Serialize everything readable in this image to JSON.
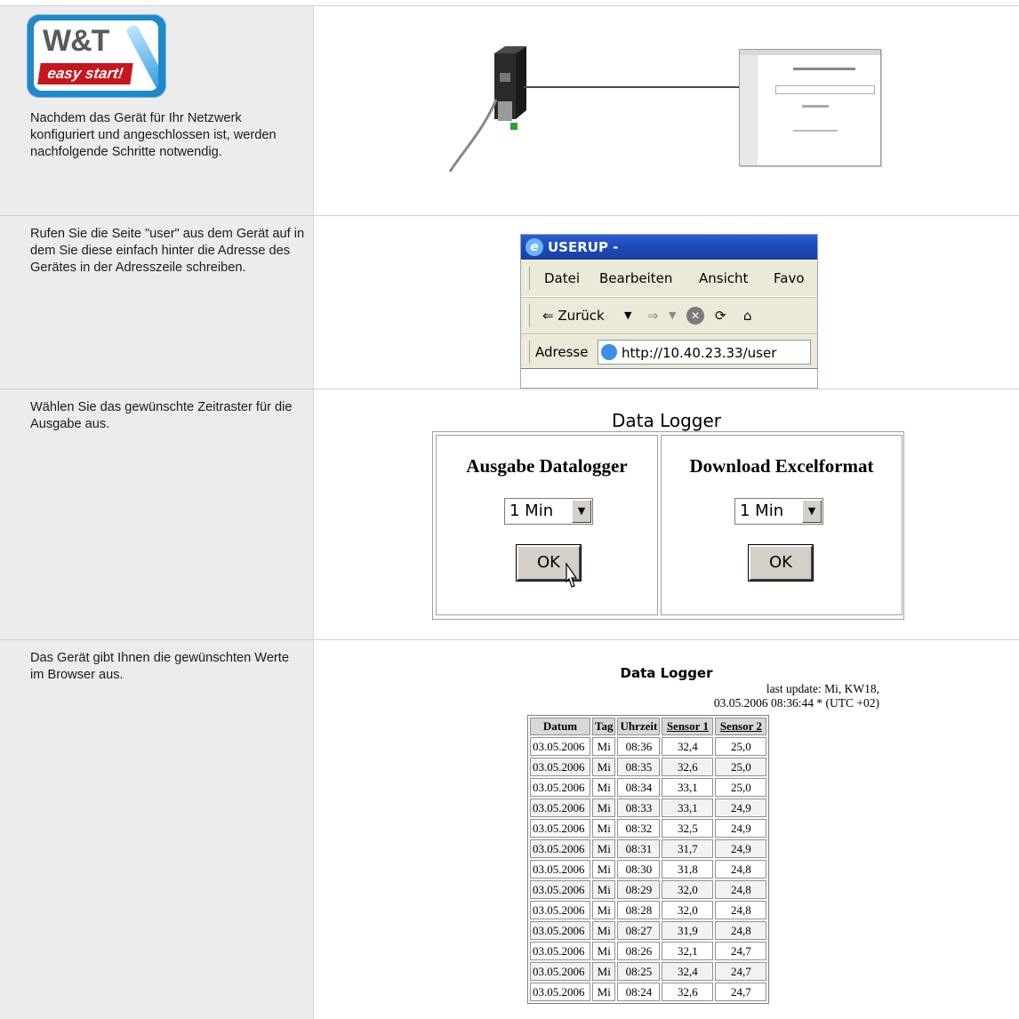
{
  "rows": [
    {
      "text": "Nachdem das Gerät für Ihr Netzwerk konfiguriert und angeschlossen ist, werden nachfolgende Schritte notwendig."
    },
    {
      "text": "Rufen Sie die Seite \"user\" aus dem Gerät auf in dem Sie diese einfach hinter die Adresse des Gerätes in der Adresszeile schreiben."
    },
    {
      "text": "Wählen Sie das gewünschte Zeitraster für die Ausgabe aus."
    },
    {
      "text": "Das Gerät gibt Ihnen die gewünschten Werte im Browser aus."
    }
  ],
  "logo": {
    "brand": "W&T",
    "tagline": "easy start!"
  },
  "browser": {
    "title": "USERUP -",
    "menu": [
      "Datei",
      "Bearbeiten",
      "Ansicht",
      "Favo"
    ],
    "back_label": "⇐ Zurück",
    "address_label": "Adresse",
    "address_value": "http://10.40.23.33/user"
  },
  "datalogger_form": {
    "title": "Data Logger",
    "left_heading": "Ausgabe Datalogger",
    "right_heading": "Download Excelformat",
    "left_select": "1 Min",
    "right_select": "1 Min",
    "ok_label": "OK"
  },
  "result": {
    "title": "Data Logger",
    "update_line1": "last update: Mi, KW18,",
    "update_line2": "03.05.2006 08:36:44 * (UTC +02)",
    "headers": [
      "Datum",
      "Tag",
      "Uhrzeit",
      "Sensor 1",
      "Sensor 2"
    ],
    "rows": [
      [
        "03.05.2006",
        "Mi",
        "08:36",
        "32,4",
        "25,0"
      ],
      [
        "03.05.2006",
        "Mi",
        "08:35",
        "32,6",
        "25,0"
      ],
      [
        "03.05.2006",
        "Mi",
        "08:34",
        "33,1",
        "25,0"
      ],
      [
        "03.05.2006",
        "Mi",
        "08:33",
        "33,1",
        "24,9"
      ],
      [
        "03.05.2006",
        "Mi",
        "08:32",
        "32,5",
        "24,9"
      ],
      [
        "03.05.2006",
        "Mi",
        "08:31",
        "31,7",
        "24,9"
      ],
      [
        "03.05.2006",
        "Mi",
        "08:30",
        "31,8",
        "24,8"
      ],
      [
        "03.05.2006",
        "Mi",
        "08:29",
        "32,0",
        "24,8"
      ],
      [
        "03.05.2006",
        "Mi",
        "08:28",
        "32,0",
        "24,8"
      ],
      [
        "03.05.2006",
        "Mi",
        "08:27",
        "31,9",
        "24,8"
      ],
      [
        "03.05.2006",
        "Mi",
        "08:26",
        "32,1",
        "24,7"
      ],
      [
        "03.05.2006",
        "Mi",
        "08:25",
        "32,4",
        "24,7"
      ],
      [
        "03.05.2006",
        "Mi",
        "08:24",
        "32,6",
        "24,7"
      ]
    ]
  }
}
